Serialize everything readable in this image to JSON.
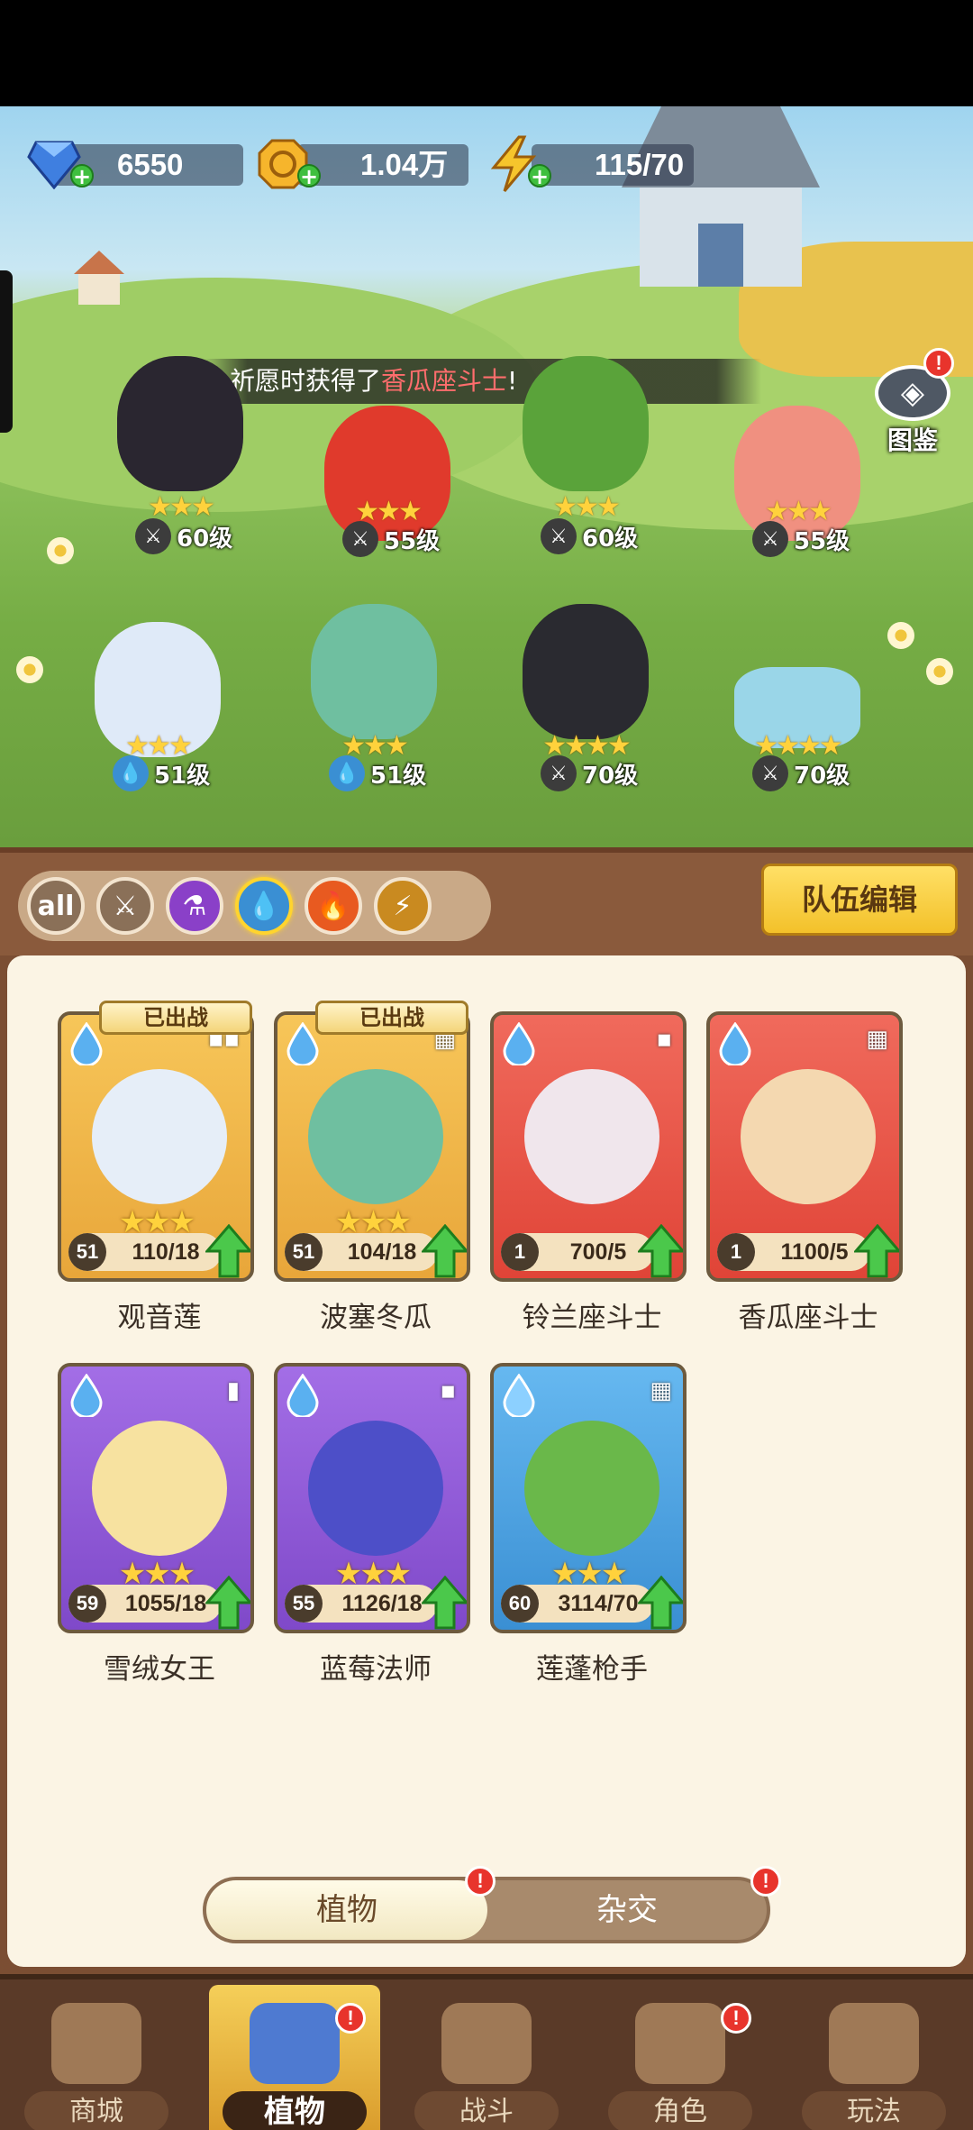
{
  "colors": {
    "highlight_red": "#ff6d6d",
    "accent_gold": "#f3c12a",
    "panel_brown": "#7b4e33"
  },
  "currency": [
    {
      "icon": "gem-icon",
      "value": "6550"
    },
    {
      "icon": "coin-icon",
      "value": "1.04万"
    },
    {
      "icon": "energy-icon",
      "value": "115/70"
    }
  ],
  "notice": {
    "prefix": "祈愿时获得了",
    "highlight": "香瓜座斗士",
    "suffix": "!"
  },
  "atlas": {
    "label": "图鉴",
    "badge": "!"
  },
  "field_units": [
    {
      "type": "sword",
      "level": "60级",
      "stars": 3
    },
    {
      "type": "sword",
      "level": "55级",
      "stars": 3
    },
    {
      "type": "sword",
      "level": "60级",
      "stars": 3
    },
    {
      "type": "sword",
      "level": "55级",
      "stars": 3
    },
    {
      "type": "water",
      "level": "51级",
      "stars": 3
    },
    {
      "type": "water",
      "level": "51级",
      "stars": 3
    },
    {
      "type": "sword",
      "level": "70级",
      "stars": 4
    },
    {
      "type": "sword",
      "level": "70级",
      "stars": 4
    }
  ],
  "filters": [
    {
      "label": "all",
      "icon": "all-icon",
      "active": false
    },
    {
      "label": "",
      "icon": "sword-icon",
      "active": false
    },
    {
      "label": "",
      "icon": "potion-icon",
      "active": false
    },
    {
      "label": "",
      "icon": "water-drop-icon",
      "active": true
    },
    {
      "label": "",
      "icon": "fire-icon",
      "active": false
    },
    {
      "label": "",
      "icon": "lightning-icon",
      "active": false
    }
  ],
  "team_edit": "队伍编辑",
  "deployed_label": "已出战",
  "plants": [
    {
      "name": "观音莲",
      "level": "51",
      "fragments": "110/18",
      "rarity": "gold",
      "stars": 3,
      "deployed": true
    },
    {
      "name": "波塞冬瓜",
      "level": "51",
      "fragments": "104/18",
      "rarity": "gold",
      "stars": 3,
      "deployed": true
    },
    {
      "name": "铃兰座斗士",
      "level": "1",
      "fragments": "700/5",
      "rarity": "red",
      "stars": 0,
      "deployed": false
    },
    {
      "name": "香瓜座斗士",
      "level": "1",
      "fragments": "1100/5",
      "rarity": "red",
      "stars": 0,
      "deployed": false
    },
    {
      "name": "雪绒女王",
      "level": "59",
      "fragments": "1055/18",
      "rarity": "purple",
      "stars": 3,
      "deployed": false
    },
    {
      "name": "蓝莓法师",
      "level": "55",
      "fragments": "1126/18",
      "rarity": "purple",
      "stars": 3,
      "deployed": false
    },
    {
      "name": "莲蓬枪手",
      "level": "60",
      "fragments": "3114/70",
      "rarity": "blue",
      "stars": 3,
      "deployed": false
    }
  ],
  "tabs": {
    "plant": "植物",
    "hybrid": "杂交",
    "badge": "!"
  },
  "nav": [
    {
      "label": "商城",
      "icon": "shop-icon",
      "active": false,
      "badge": ""
    },
    {
      "label": "植物",
      "icon": "plants-icon",
      "active": true,
      "badge": "!"
    },
    {
      "label": "战斗",
      "icon": "battle-icon",
      "active": false,
      "badge": ""
    },
    {
      "label": "角色",
      "icon": "character-icon",
      "active": false,
      "badge": "!"
    },
    {
      "label": "玩法",
      "icon": "gameplay-icon",
      "active": false,
      "badge": ""
    }
  ]
}
